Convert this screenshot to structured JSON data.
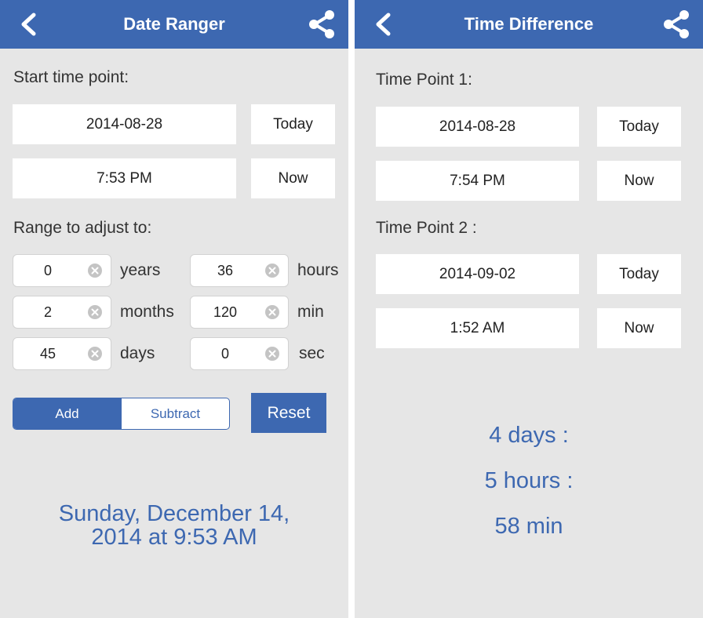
{
  "colors": {
    "accent": "#3d68b1",
    "background": "#e6e6e6"
  },
  "date_ranger": {
    "title": "Date Ranger",
    "back_icon": "chevron-left-icon",
    "share_icon": "share-icon",
    "start_label": "Start time point:",
    "start_date": "2014-08-28",
    "today_label": "Today",
    "start_time": "7:53 PM",
    "now_label": "Now",
    "range_label": "Range to adjust to:",
    "range": {
      "years": {
        "value": "0",
        "unit": "years"
      },
      "months": {
        "value": "2",
        "unit": "months"
      },
      "days": {
        "value": "45",
        "unit": "days"
      },
      "hours": {
        "value": "36",
        "unit": "hours"
      },
      "min": {
        "value": "120",
        "unit": "min"
      },
      "sec": {
        "value": "0",
        "unit": "sec"
      }
    },
    "mode": {
      "add": "Add",
      "subtract": "Subtract",
      "selected": "Add"
    },
    "reset_label": "Reset",
    "result_line1": "Sunday, December 14,",
    "result_line2": "2014 at 9:53 AM"
  },
  "time_difference": {
    "title": "Time Difference",
    "back_icon": "chevron-left-icon",
    "share_icon": "share-icon",
    "point1_label": "Time Point 1:",
    "point1_date": "2014-08-28",
    "point1_time": "7:54 PM",
    "point2_label": "Time Point 2 :",
    "point2_date": "2014-09-02",
    "point2_time": "1:52 AM",
    "today_label": "Today",
    "now_label": "Now",
    "diff_days": "4 days :",
    "diff_hours": "5 hours :",
    "diff_min": "58 min"
  }
}
